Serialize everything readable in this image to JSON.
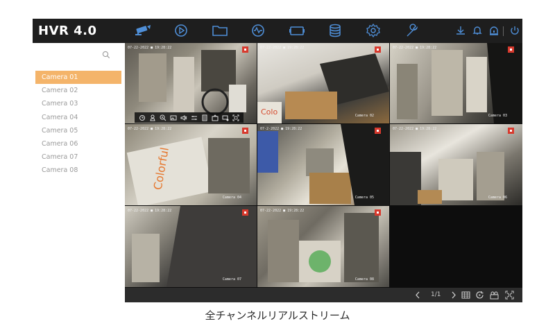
{
  "app": {
    "title": "HVR 4.0"
  },
  "topbar": {
    "nav_icons": [
      "live-view-camera-icon",
      "playback-icon",
      "file-folder-icon",
      "analytics-icon",
      "camera-device-icon",
      "storage-icon",
      "settings-gear-icon",
      "maintenance-wrench-icon"
    ],
    "right_icons": [
      "download-icon",
      "alarm-bell-icon",
      "alert-icon",
      "power-icon"
    ]
  },
  "sidebar": {
    "search_icon": "search-icon",
    "cameras": [
      {
        "label": "Camera 01",
        "selected": true
      },
      {
        "label": "Camera 02",
        "selected": false
      },
      {
        "label": "Camera 03",
        "selected": false
      },
      {
        "label": "Camera 04",
        "selected": false
      },
      {
        "label": "Camera 05",
        "selected": false
      },
      {
        "label": "Camera 06",
        "selected": false
      },
      {
        "label": "Camera 07",
        "selected": false
      },
      {
        "label": "Camera 08",
        "selected": false
      }
    ]
  },
  "tiles": [
    {
      "timestamp": "07-22-2022 ■ 19:28:22",
      "name": "",
      "empty": false
    },
    {
      "timestamp": "07-22-2022 ■ 19:28:22",
      "name": "Camera 02",
      "empty": false
    },
    {
      "timestamp": "07-22-2022 ■ 19:28:22",
      "name": "Camera 03",
      "empty": false
    },
    {
      "timestamp": "07-22-2022 ■ 19:28:22",
      "name": "Camera 04",
      "empty": false
    },
    {
      "timestamp": "07-2-2022 ■ 19:28:22",
      "name": "Camera 05",
      "empty": false
    },
    {
      "timestamp": "07-22-2022 ■ 19:28:22",
      "name": "Camera 06",
      "empty": false
    },
    {
      "timestamp": "07-22-2022 ■ 19:28:22",
      "name": "Camera 07",
      "empty": false
    },
    {
      "timestamp": "07-22-2022 ■ 19:28:22",
      "name": "Camera 08",
      "empty": false
    },
    {
      "timestamp": "",
      "name": "",
      "empty": true
    }
  ],
  "tile_toolbar": {
    "icons": [
      "instant-playback-icon",
      "ptz-icon",
      "digital-zoom-icon",
      "capture-icon",
      "audio-icon",
      "image-settings-icon",
      "clip-icon",
      "stream-icon",
      "camera-settings-icon",
      "fullscreen-icon"
    ]
  },
  "bottombar": {
    "page_indicator": "1/1",
    "icons": [
      "prev-page-icon",
      "next-page-icon",
      "grid-layout-icon",
      "cycle-icon",
      "camera-group-icon",
      "fullscreen-icon"
    ]
  },
  "caption": "全チャンネルリアルストリーム",
  "colors": {
    "accent": "#f4b46a",
    "topbar": "#1e1e1e",
    "icon_blue": "#4f8fd8",
    "record": "#d83a2e"
  }
}
